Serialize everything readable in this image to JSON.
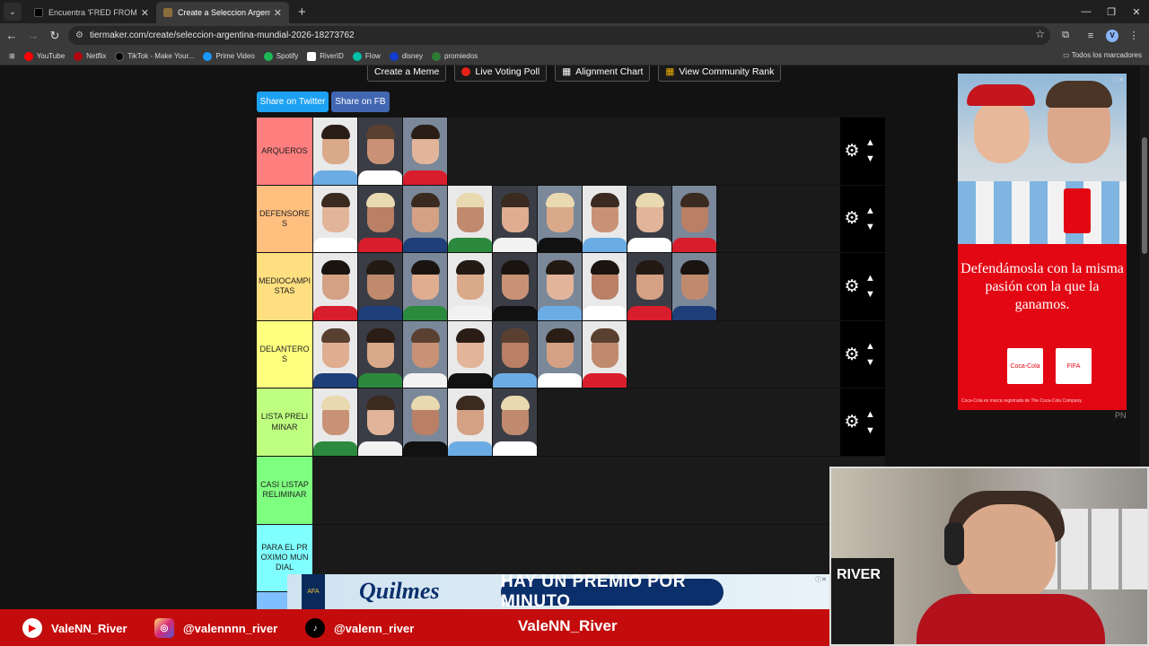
{
  "browser": {
    "tabs": [
      {
        "title": "Encuentra 'FRED FROM DESIRE",
        "active": false
      },
      {
        "title": "Create a Seleccion Argentina M",
        "active": true
      }
    ],
    "url": "tiermaker.com/create/seleccion-argentina-mundial-2026-18273762",
    "bookmarks": [
      "YouTube",
      "Netflix",
      "TikTok - Make Your...",
      "Prime Video",
      "Spotify",
      "RiverID",
      "Flow",
      "disney",
      "promiedos"
    ],
    "all_bookmarks": "Todos los marcadores",
    "profile_initial": "V"
  },
  "toolbar": {
    "create_meme": "Create a Meme",
    "live_voting": "Live Voting Poll",
    "alignment_chart": "Alignment Chart",
    "community_rank": "View Community Rank"
  },
  "share": {
    "twitter": "Share on Twitter",
    "facebook": "Share on FB"
  },
  "tiers": [
    {
      "label": "ARQUEROS",
      "color": "#ff7f7f",
      "count": 3
    },
    {
      "label": "DEFENSORES",
      "color": "#ffbf7f",
      "count": 9
    },
    {
      "label": "MEDIOCAMPISTAS",
      "color": "#ffdf7f",
      "count": 9
    },
    {
      "label": "DELANTEROS",
      "color": "#ffff7f",
      "count": 7
    },
    {
      "label": "LISTA PRELIMINAR",
      "color": "#bfff7f",
      "count": 5
    },
    {
      "label": "CASI LISTAPRELIMINAR",
      "color": "#7fff7f",
      "count": 0
    },
    {
      "label": "PARA EL PROXIMO MUNDIAL",
      "color": "#7fffff",
      "count": 0
    },
    {
      "label": "",
      "color": "#7fbfff",
      "count": 11
    }
  ],
  "ad": {
    "text": "Defendámosla con la misma pasión con la que la ganamos.",
    "logo1": "Coca-Cola",
    "logo2": "FIFA",
    "footnote": "Coca-Cola es marca registrada de The Coca-Cola Company.",
    "partner": "OFFICIAL PARTNER"
  },
  "pn": "PN",
  "promo": {
    "brand": "Quilmes",
    "slogan": "HAY UN PREMIO POR MINUTO"
  },
  "stream": {
    "youtube": "ValeNN_River",
    "instagram": "@valennnn_river",
    "tiktok": "@valenn_river",
    "channel": "ValeNN_River",
    "webcam_text": "RIVER"
  }
}
